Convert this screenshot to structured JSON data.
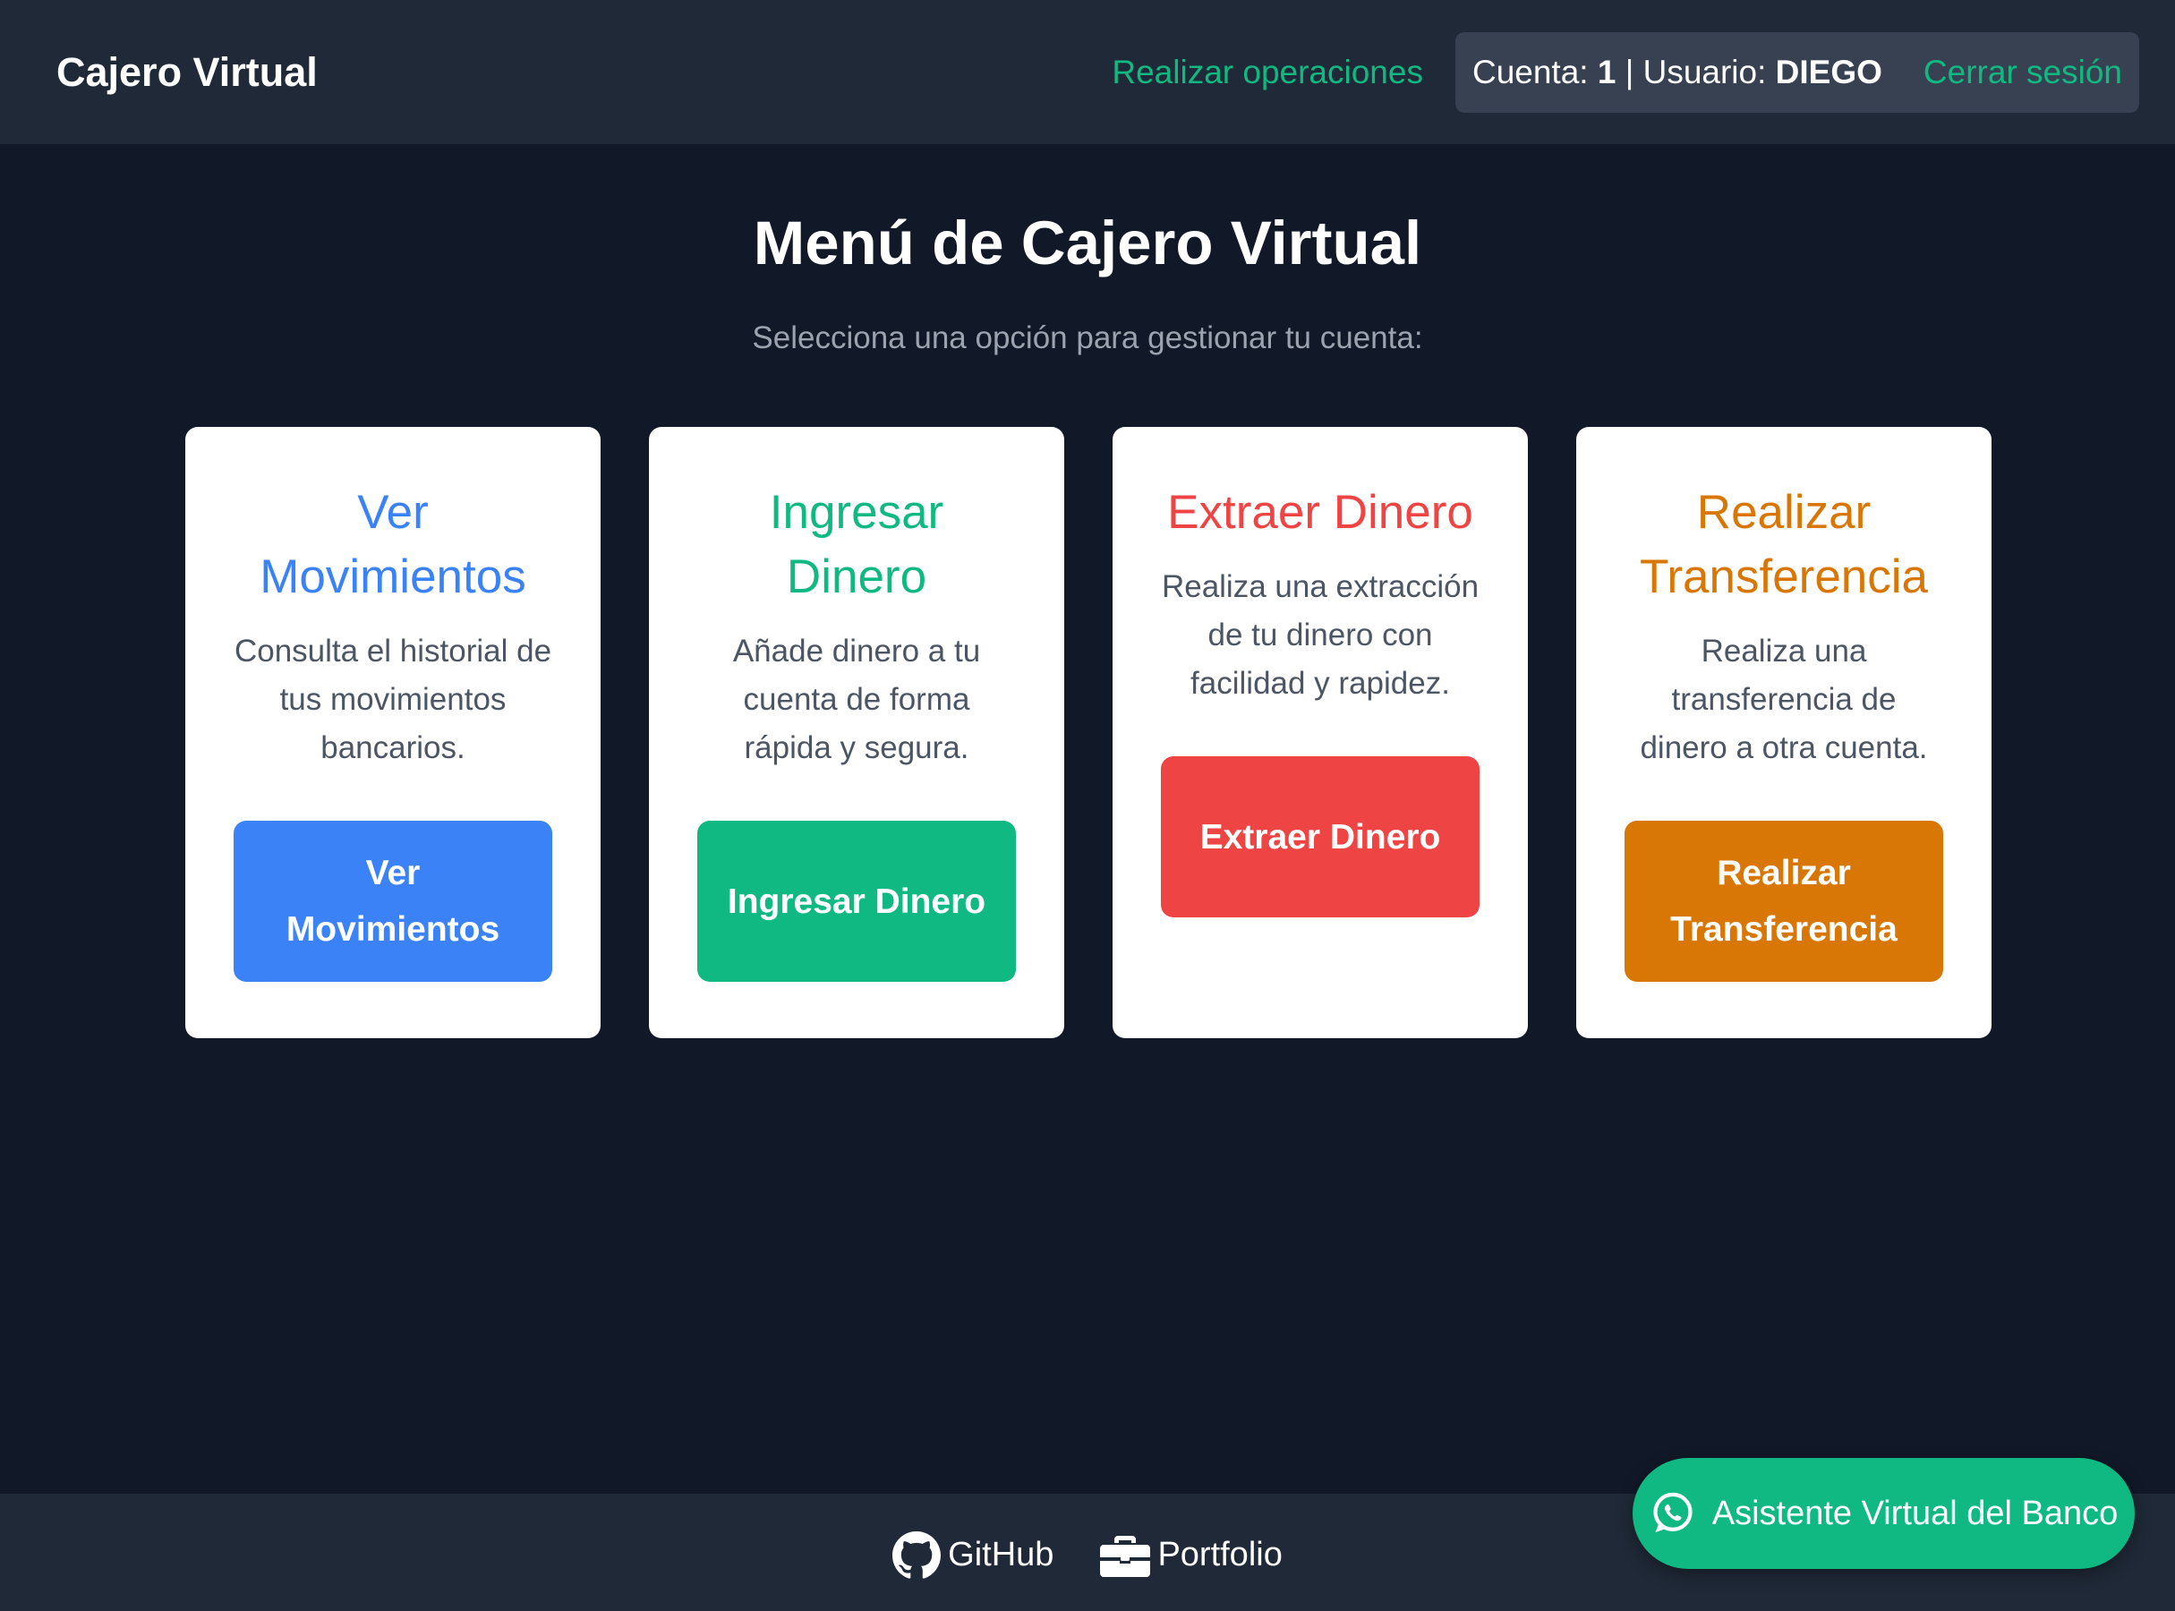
{
  "navbar": {
    "brand": "Cajero Virtual",
    "operations_link": "Realizar operaciones",
    "account_label": "Cuenta:",
    "account_number": "1",
    "separator": "|",
    "user_label": "Usuario:",
    "user_name": "DIEGO",
    "logout_link": "Cerrar sesión"
  },
  "main": {
    "title": "Menú de Cajero Virtual",
    "subtitle": "Selecciona una opción para gestionar tu cuenta:",
    "cards": [
      {
        "title": "Ver Movimientos",
        "description": "Consulta el historial de tus movimientos bancarios.",
        "button": "Ver Movimientos",
        "color": "#3b82f6"
      },
      {
        "title": "Ingresar Dinero",
        "description": "Añade dinero a tu cuenta de forma rápida y segura.",
        "button": "Ingresar Dinero",
        "color": "#10b981"
      },
      {
        "title": "Extraer Dinero",
        "description": "Realiza una extracción de tu dinero con facilidad y rapidez.",
        "button": "Extraer Dinero",
        "color": "#ef4444"
      },
      {
        "title": "Realizar Transferencia",
        "description": "Realiza una transferencia de dinero a otra cuenta.",
        "button": "Realizar Transferencia",
        "color": "#d97706"
      }
    ]
  },
  "footer": {
    "github": {
      "label": "GitHub",
      "icon": "github-icon"
    },
    "portfolio": {
      "label": "Portfolio",
      "icon": "briefcase-icon"
    }
  },
  "assistant": {
    "label": "Asistente Virtual del Banco",
    "icon": "whatsapp-icon"
  },
  "colors": {
    "background": "#111827",
    "navbar": "#1f2937",
    "accent": "#10b981",
    "account_box": "#374151"
  }
}
